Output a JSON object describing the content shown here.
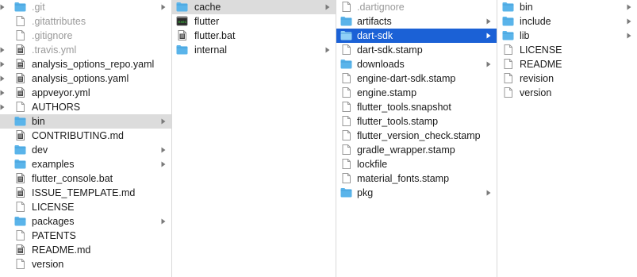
{
  "columns": [
    {
      "items": [
        {
          "label": ".git",
          "kind": "folder",
          "dim": true,
          "chevron": true,
          "edge": true
        },
        {
          "label": ".gitattributes",
          "kind": "file",
          "dim": true,
          "edge": false
        },
        {
          "label": ".gitignore",
          "kind": "file",
          "dim": true,
          "edge": false
        },
        {
          "label": ".travis.yml",
          "kind": "file-text",
          "dim": true,
          "edge": true
        },
        {
          "label": "analysis_options_repo.yaml",
          "kind": "file-text",
          "edge": true
        },
        {
          "label": "analysis_options.yaml",
          "kind": "file-text",
          "edge": true
        },
        {
          "label": "appveyor.yml",
          "kind": "file-text",
          "edge": true
        },
        {
          "label": "AUTHORS",
          "kind": "file",
          "edge": true
        },
        {
          "label": "bin",
          "kind": "folder",
          "chevron": true,
          "selected": "gray"
        },
        {
          "label": "CONTRIBUTING.md",
          "kind": "file-text"
        },
        {
          "label": "dev",
          "kind": "folder",
          "chevron": true
        },
        {
          "label": "examples",
          "kind": "folder",
          "chevron": true
        },
        {
          "label": "flutter_console.bat",
          "kind": "file-text"
        },
        {
          "label": "ISSUE_TEMPLATE.md",
          "kind": "file-text"
        },
        {
          "label": "LICENSE",
          "kind": "file"
        },
        {
          "label": "packages",
          "kind": "folder",
          "chevron": true
        },
        {
          "label": "PATENTS",
          "kind": "file"
        },
        {
          "label": "README.md",
          "kind": "file-text"
        },
        {
          "label": "version",
          "kind": "file"
        }
      ]
    },
    {
      "items": [
        {
          "label": "cache",
          "kind": "folder",
          "chevron": true,
          "selected": "gray"
        },
        {
          "label": "flutter",
          "kind": "exec"
        },
        {
          "label": "flutter.bat",
          "kind": "file-text"
        },
        {
          "label": "internal",
          "kind": "folder",
          "chevron": true
        }
      ]
    },
    {
      "items": [
        {
          "label": ".dartignore",
          "kind": "file",
          "dim": true
        },
        {
          "label": "artifacts",
          "kind": "folder",
          "chevron": true
        },
        {
          "label": "dart-sdk",
          "kind": "folder",
          "chevron": true,
          "selected": "blue"
        },
        {
          "label": "dart-sdk.stamp",
          "kind": "file"
        },
        {
          "label": "downloads",
          "kind": "folder",
          "chevron": true
        },
        {
          "label": "engine-dart-sdk.stamp",
          "kind": "file"
        },
        {
          "label": "engine.stamp",
          "kind": "file"
        },
        {
          "label": "flutter_tools.snapshot",
          "kind": "file"
        },
        {
          "label": "flutter_tools.stamp",
          "kind": "file"
        },
        {
          "label": "flutter_version_check.stamp",
          "kind": "file"
        },
        {
          "label": "gradle_wrapper.stamp",
          "kind": "file"
        },
        {
          "label": "lockfile",
          "kind": "file"
        },
        {
          "label": "material_fonts.stamp",
          "kind": "file"
        },
        {
          "label": "pkg",
          "kind": "folder",
          "chevron": true
        }
      ]
    },
    {
      "items": [
        {
          "label": "bin",
          "kind": "folder",
          "chevron": true
        },
        {
          "label": "include",
          "kind": "folder",
          "chevron": true
        },
        {
          "label": "lib",
          "kind": "folder",
          "chevron": true
        },
        {
          "label": "LICENSE",
          "kind": "file"
        },
        {
          "label": "README",
          "kind": "file"
        },
        {
          "label": "revision",
          "kind": "file"
        },
        {
          "label": "version",
          "kind": "file"
        }
      ]
    }
  ],
  "colors": {
    "folder": "#5ab4ea",
    "selection_blue": "#1b61d6",
    "selection_gray": "#dcdcdc",
    "chevron": "#7a7a7a"
  }
}
